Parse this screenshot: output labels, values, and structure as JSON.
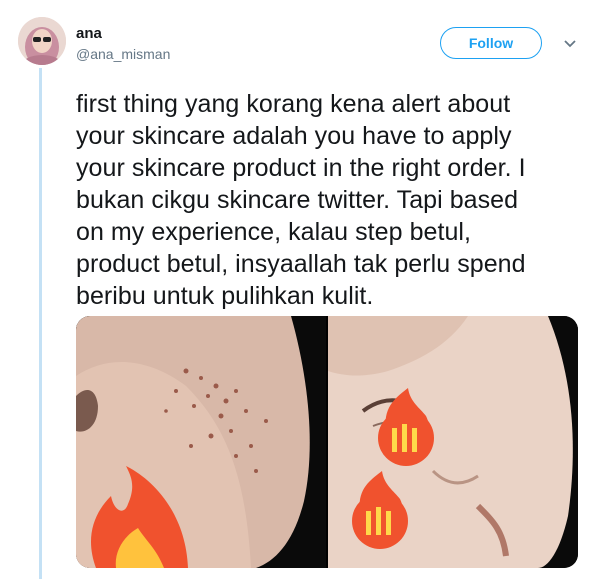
{
  "user": {
    "display_name": "ana",
    "handle": "@ana_misman",
    "follow_label": "Follow"
  },
  "tweet": {
    "text": "first thing yang korang kena alert about\nyour skincare adalah you have to apply\nyour skincare product in the right order. I\nbukan cikgu skincare twitter. Tapi based\non my experience, kalau step betul,\nproduct betul, insyaallah tak perlu spend\nberibu untuk pulihkan kulit."
  },
  "media": {
    "photos": [
      {
        "icon": "lit-fire-emoji"
      },
      {
        "icon": "lit-fire-emoji"
      }
    ]
  },
  "colors": {
    "accent": "#1da1f2",
    "thread_line": "#c4e1f5",
    "secondary_text": "#657786"
  }
}
